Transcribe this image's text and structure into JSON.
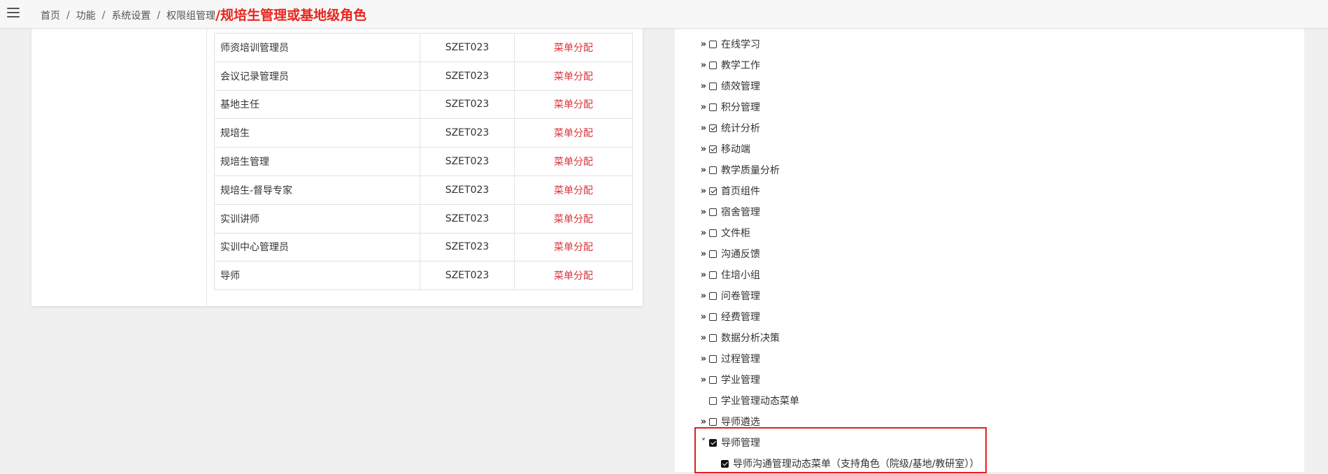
{
  "breadcrumb": {
    "items": [
      "首页",
      "功能",
      "系统设置",
      "权限组管理"
    ],
    "separator": "/",
    "annotation": "/规培生管理或基地级角色"
  },
  "roles": [
    {
      "name": "师资培训管理员",
      "code": "SZET023",
      "action": "菜单分配"
    },
    {
      "name": "会议记录管理员",
      "code": "SZET023",
      "action": "菜单分配"
    },
    {
      "name": "基地主任",
      "code": "SZET023",
      "action": "菜单分配"
    },
    {
      "name": "规培生",
      "code": "SZET023",
      "action": "菜单分配"
    },
    {
      "name": "规培生管理",
      "code": "SZET023",
      "action": "菜单分配"
    },
    {
      "name": "规培生-督导专家",
      "code": "SZET023",
      "action": "菜单分配"
    },
    {
      "name": "实训讲师",
      "code": "SZET023",
      "action": "菜单分配"
    },
    {
      "name": "实训中心管理员",
      "code": "SZET023",
      "action": "菜单分配"
    },
    {
      "name": "导师",
      "code": "SZET023",
      "action": "菜单分配"
    }
  ],
  "menu_tree": [
    {
      "label": "在线学习",
      "toggle": "collapsed",
      "checked": false
    },
    {
      "label": "教学工作",
      "toggle": "collapsed",
      "checked": false
    },
    {
      "label": "绩效管理",
      "toggle": "collapsed",
      "checked": false
    },
    {
      "label": "积分管理",
      "toggle": "collapsed",
      "checked": false
    },
    {
      "label": "统计分析",
      "toggle": "collapsed",
      "checked": true
    },
    {
      "label": "移动端",
      "toggle": "collapsed",
      "checked": true
    },
    {
      "label": "教学质量分析",
      "toggle": "collapsed",
      "checked": false
    },
    {
      "label": "首页组件",
      "toggle": "collapsed",
      "checked": true
    },
    {
      "label": "宿舍管理",
      "toggle": "collapsed",
      "checked": false
    },
    {
      "label": "文件柜",
      "toggle": "collapsed",
      "checked": false
    },
    {
      "label": "沟通反馈",
      "toggle": "collapsed",
      "checked": false
    },
    {
      "label": "住培小组",
      "toggle": "collapsed",
      "checked": false
    },
    {
      "label": "问卷管理",
      "toggle": "collapsed",
      "checked": false
    },
    {
      "label": "经费管理",
      "toggle": "collapsed",
      "checked": false
    },
    {
      "label": "数据分析决策",
      "toggle": "collapsed",
      "checked": false
    },
    {
      "label": "过程管理",
      "toggle": "collapsed",
      "checked": false
    },
    {
      "label": "学业管理",
      "toggle": "collapsed",
      "checked": false
    },
    {
      "label": "学业管理动态菜单",
      "toggle": "none",
      "checked": false
    },
    {
      "label": "导师遴选",
      "toggle": "collapsed",
      "checked": false
    },
    {
      "label": "导师管理",
      "toggle": "expanded",
      "checked": true,
      "filled": true
    },
    {
      "label": "导师沟通管理动态菜单（支持角色（院级/基地/教研室））",
      "toggle": "none",
      "checked": true,
      "filled": true,
      "child": true
    }
  ],
  "colors": {
    "menu_link": "#d9363e",
    "annotation": "#e8251f",
    "highlight_box": "#e02020"
  }
}
